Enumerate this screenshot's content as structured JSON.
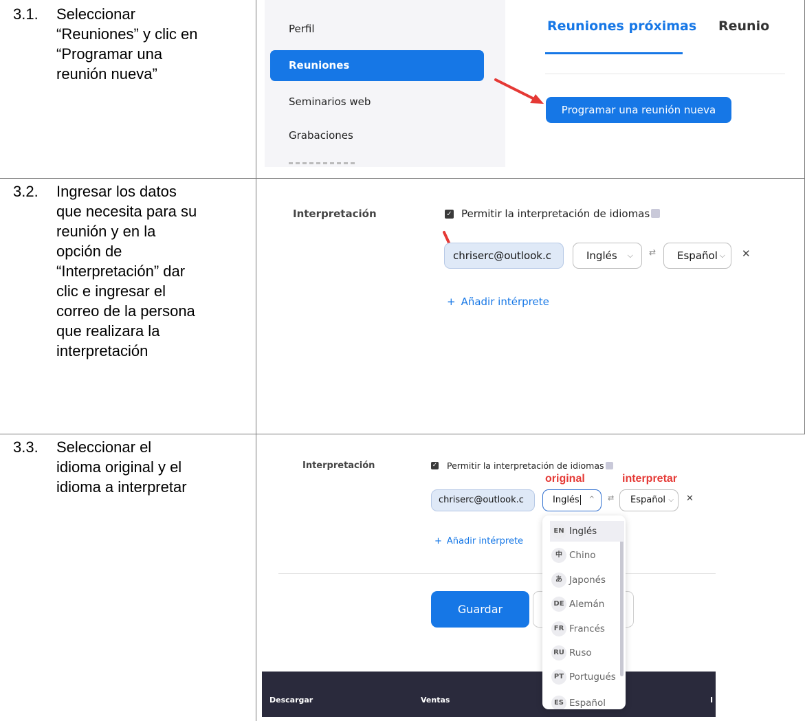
{
  "steps": [
    {
      "num": "3.1.",
      "lines": [
        "Seleccionar",
        "“Reuniones” y clic en",
        "“Programar una",
        "reunión nueva”"
      ]
    },
    {
      "num": "3.2.",
      "lines": [
        "Ingresar los datos",
        "que necesita para su",
        "reunión y en la",
        "opción de",
        "“Interpretación” dar",
        "clic e ingresar el",
        "correo de la persona",
        "que realizara la",
        "interpretación"
      ]
    },
    {
      "num": "3.3.",
      "lines": [
        "Seleccionar el",
        "idioma original y el",
        "idioma a interpretar"
      ]
    }
  ],
  "panel1": {
    "nav": [
      "Perfil",
      "Reuniones",
      "Seminarios web",
      "Grabaciones"
    ],
    "tab_active": "Reuniones próximas",
    "tab_other": "Reunio",
    "schedule_button": "Programar una reunión nueva"
  },
  "panel2": {
    "label": "Interpretación",
    "checkbox_label": "Permitir la interpretación de idiomas",
    "email": "chriserc@outlook.c",
    "source_lang": "Inglés",
    "target_lang": "Español",
    "add_interpreter": "Añadir intérprete"
  },
  "panel3": {
    "label": "Interpretación",
    "checkbox_label": "Permitir la interpretación de idiomas",
    "annot_original": "original",
    "annot_interpretar": "interpretar",
    "email": "chriserc@outlook.c",
    "source_lang": "Inglés",
    "target_lang": "Español",
    "add_interpreter": "Añadir intérprete",
    "save_button": "Guardar",
    "dropdown": [
      {
        "code": "EN",
        "name": "Inglés"
      },
      {
        "code": "中",
        "name": "Chino"
      },
      {
        "code": "あ",
        "name": "Japonés"
      },
      {
        "code": "DE",
        "name": "Alemán"
      },
      {
        "code": "FR",
        "name": "Francés"
      },
      {
        "code": "RU",
        "name": "Ruso"
      },
      {
        "code": "PT",
        "name": "Portugués"
      },
      {
        "code": "ES",
        "name": "Español"
      }
    ],
    "footer": {
      "col1": "Descargar",
      "col2": "Ventas",
      "col3": "I"
    }
  },
  "colors": {
    "accent": "#1677e6",
    "annotation": "#e53935"
  }
}
